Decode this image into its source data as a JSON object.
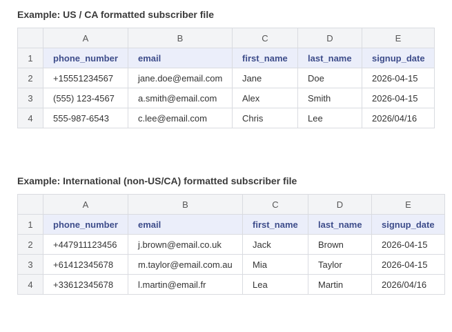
{
  "sections": [
    {
      "title": "Example: US / CA formatted subscriber file",
      "columns": [
        "A",
        "B",
        "C",
        "D",
        "E"
      ],
      "rows": [
        {
          "num": "1",
          "cells": [
            "phone_number",
            "email",
            "first_name",
            "last_name",
            "signup_date"
          ]
        },
        {
          "num": "2",
          "cells": [
            "+15551234567",
            "jane.doe@email.com",
            "Jane",
            "Doe",
            "2026-04-15"
          ]
        },
        {
          "num": "3",
          "cells": [
            "(555) 123-4567",
            "a.smith@email.com",
            "Alex",
            "Smith",
            "2026-04-15"
          ]
        },
        {
          "num": "4",
          "cells": [
            "555-987-6543",
            "c.lee@email.com",
            "Chris",
            "Lee",
            "2026/04/16"
          ]
        }
      ]
    },
    {
      "title": "Example: International (non-US/CA) formatted subscriber file",
      "columns": [
        "A",
        "B",
        "C",
        "D",
        "E"
      ],
      "rows": [
        {
          "num": "1",
          "cells": [
            "phone_number",
            "email",
            "first_name",
            "last_name",
            "signup_date"
          ]
        },
        {
          "num": "2",
          "cells": [
            "+447911123456",
            "j.brown@email.co.uk",
            "Jack",
            "Brown",
            "2026-04-15"
          ]
        },
        {
          "num": "3",
          "cells": [
            "+61412345678",
            "m.taylor@email.com.au",
            "Mia",
            "Taylor",
            "2026-04-15"
          ]
        },
        {
          "num": "4",
          "cells": [
            "+33612345678",
            "l.martin@email.fr",
            "Lea",
            "Martin",
            "2026/04/16"
          ]
        }
      ]
    }
  ]
}
